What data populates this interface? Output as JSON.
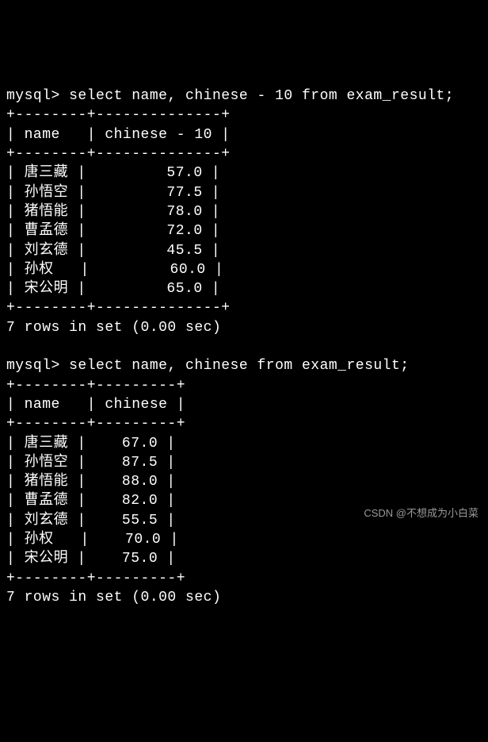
{
  "query1": {
    "prompt": "mysql>",
    "sql": "select name, chinese - 10 from exam_result;",
    "border_top": "+--------+--------------+",
    "header_line": "| name   | chinese - 10 |",
    "border_mid": "+--------+--------------+",
    "rows": [
      "| 唐三藏 |         57.0 |",
      "| 孙悟空 |         77.5 |",
      "| 猪悟能 |         78.0 |",
      "| 曹孟德 |         72.0 |",
      "| 刘玄德 |         45.5 |",
      "| 孙权   |         60.0 |",
      "| 宋公明 |         65.0 |"
    ],
    "border_bot": "+--------+--------------+",
    "footer": "7 rows in set (0.00 sec)"
  },
  "query2": {
    "prompt": "mysql>",
    "sql": "select name, chinese from exam_result;",
    "border_top": "+--------+---------+",
    "header_line": "| name   | chinese |",
    "border_mid": "+--------+---------+",
    "rows": [
      "| 唐三藏 |    67.0 |",
      "| 孙悟空 |    87.5 |",
      "| 猪悟能 |    88.0 |",
      "| 曹孟德 |    82.0 |",
      "| 刘玄德 |    55.5 |",
      "| 孙权   |    70.0 |",
      "| 宋公明 |    75.0 |"
    ],
    "border_bot": "+--------+---------+",
    "footer": "7 rows in set (0.00 sec)"
  },
  "watermark": "CSDN @不想成为小白菜",
  "chart_data": [
    {
      "type": "table",
      "title": "select name, chinese - 10 from exam_result",
      "columns": [
        "name",
        "chinese - 10"
      ],
      "data": [
        [
          "唐三藏",
          57.0
        ],
        [
          "孙悟空",
          77.5
        ],
        [
          "猪悟能",
          78.0
        ],
        [
          "曹孟德",
          72.0
        ],
        [
          "刘玄德",
          45.5
        ],
        [
          "孙权",
          60.0
        ],
        [
          "宋公明",
          65.0
        ]
      ]
    },
    {
      "type": "table",
      "title": "select name, chinese from exam_result",
      "columns": [
        "name",
        "chinese"
      ],
      "data": [
        [
          "唐三藏",
          67.0
        ],
        [
          "孙悟空",
          87.5
        ],
        [
          "猪悟能",
          88.0
        ],
        [
          "曹孟德",
          82.0
        ],
        [
          "刘玄德",
          55.5
        ],
        [
          "孙权",
          70.0
        ],
        [
          "宋公明",
          75.0
        ]
      ]
    }
  ]
}
